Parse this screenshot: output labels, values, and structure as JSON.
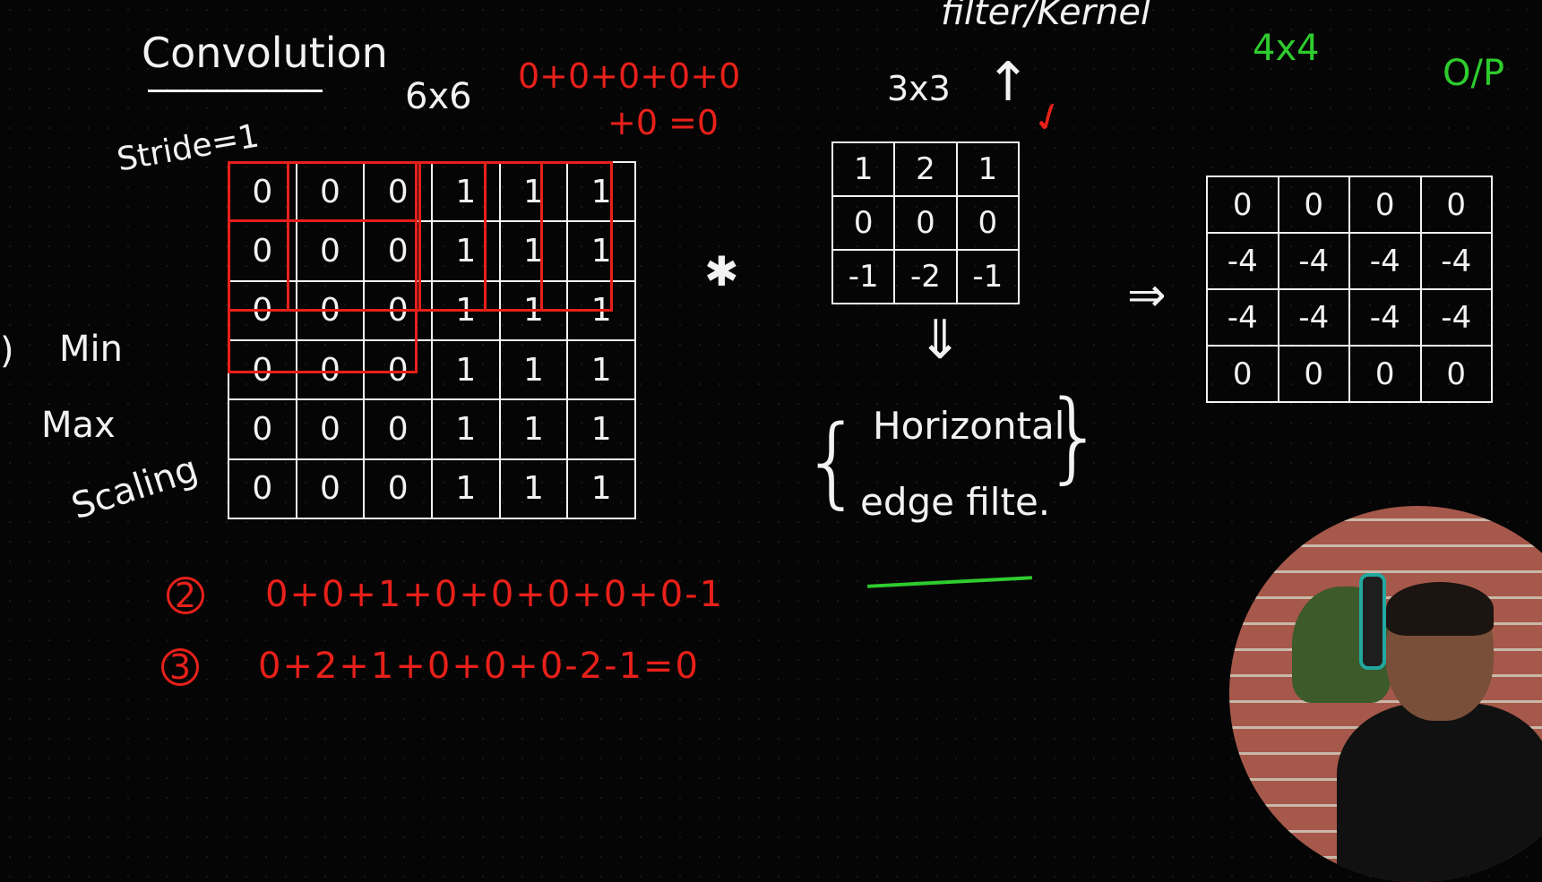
{
  "title": "Convolution",
  "stride_label": "Stride=1",
  "input_size_label": "6x6",
  "filter_label": "filter/Kernel",
  "filter_size_label": "3x3",
  "output_size_label": "4x4",
  "output_label": "O/P",
  "side_labels": {
    "circle": ")",
    "min": "Min",
    "max": "Max",
    "scaling": "Scaling"
  },
  "calc1": {
    "line1": "0+0+0+0+0",
    "line2": "+0 =0"
  },
  "calc2": {
    "number": "2",
    "expr": "0+0+1+0+0+0+0+0-1"
  },
  "calc3": {
    "number": "3",
    "expr": "0+2+1+0+0+0-2-1=0"
  },
  "convolve_symbol": "✱",
  "arrow_right": "⇒",
  "arrow_up": "↑",
  "arrow_down": "⇓",
  "bracket_left": "{",
  "bracket_right": "}",
  "filter_desc": {
    "line1": "Horizontal",
    "line2": "edge filte."
  },
  "input_matrix": [
    [
      "0",
      "0",
      "0",
      "1",
      "1",
      "1"
    ],
    [
      "0",
      "0",
      "0",
      "1",
      "1",
      "1"
    ],
    [
      "0",
      "0",
      "0",
      "1",
      "1",
      "1"
    ],
    [
      "0",
      "0",
      "0",
      "1",
      "1",
      "1"
    ],
    [
      "0",
      "0",
      "0",
      "1",
      "1",
      "1"
    ],
    [
      "0",
      "0",
      "0",
      "1",
      "1",
      "1"
    ]
  ],
  "filter_matrix": [
    [
      "1",
      "2",
      "1"
    ],
    [
      "0",
      "0",
      "0"
    ],
    [
      "-1",
      "-2",
      "-1"
    ]
  ],
  "output_matrix": [
    [
      "0",
      "0",
      "0",
      "0"
    ],
    [
      "-4",
      "-4",
      "-4",
      "-4"
    ],
    [
      "-4",
      "-4",
      "-4",
      "-4"
    ],
    [
      "0",
      "0",
      "0",
      "0"
    ]
  ],
  "colors": {
    "chalk": "#f2f2f2",
    "red": "#e8201a",
    "green": "#2ecc2e",
    "board": "#050505"
  }
}
